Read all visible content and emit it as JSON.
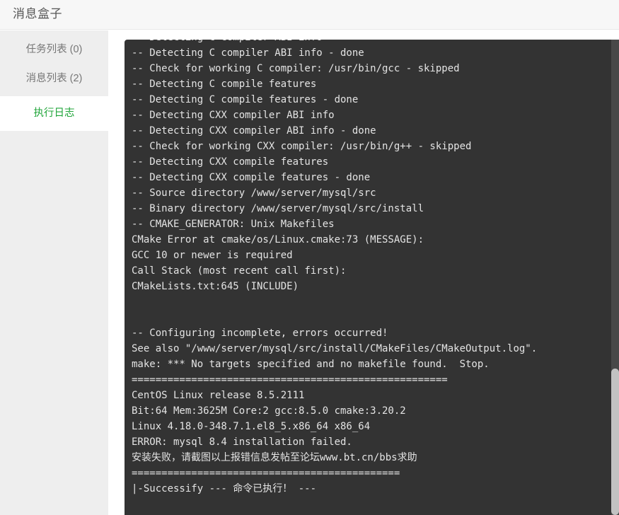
{
  "header": {
    "title": "消息盒子"
  },
  "sidebar": {
    "items": [
      {
        "label": "任务列表 (0)",
        "name": "sidebar-item-task-list",
        "active": false
      },
      {
        "label": "消息列表 (2)",
        "name": "sidebar-item-message-list",
        "active": false
      },
      {
        "label": "执行日志",
        "name": "sidebar-item-execution-log",
        "active": true
      }
    ]
  },
  "colors": {
    "accent_green": "#20a53a",
    "sidebar_bg": "#eeeeee",
    "header_bg": "#f7f7f7",
    "log_bg": "#333333",
    "log_text": "#e4e4e4",
    "scrollbar_thumb": "#c2c2c2",
    "scrollbar_track": "#484848"
  },
  "log": {
    "lines": [
      "-- Detecting C compiler ABI info",
      "-- Detecting C compiler ABI info - done",
      "-- Check for working C compiler: /usr/bin/gcc - skipped",
      "-- Detecting C compile features",
      "-- Detecting C compile features - done",
      "-- Detecting CXX compiler ABI info",
      "-- Detecting CXX compiler ABI info - done",
      "-- Check for working CXX compiler: /usr/bin/g++ - skipped",
      "-- Detecting CXX compile features",
      "-- Detecting CXX compile features - done",
      "-- Source directory /www/server/mysql/src",
      "-- Binary directory /www/server/mysql/src/install",
      "-- CMAKE_GENERATOR: Unix Makefiles",
      "CMake Error at cmake/os/Linux.cmake:73 (MESSAGE):",
      "GCC 10 or newer is required",
      "Call Stack (most recent call first):",
      "CMakeLists.txt:645 (INCLUDE)",
      "",
      "",
      "-- Configuring incomplete, errors occurred!",
      "See also \"/www/server/mysql/src/install/CMakeFiles/CMakeOutput.log\".",
      "make: *** No targets specified and no makefile found.  Stop.",
      "=====================================================",
      "CentOS Linux release 8.5.2111",
      "Bit:64 Mem:3625M Core:2 gcc:8.5.0 cmake:3.20.2",
      "Linux 4.18.0-348.7.1.el8_5.x86_64 x86_64",
      "ERROR: mysql 8.4 installation failed.",
      "安装失败，请截图以上报错信息发帖至论坛www.bt.cn/bbs求助",
      "=============================================",
      "|-Successify --- 命令已执行！ ---"
    ]
  },
  "scrollbar": {
    "name": "log-scrollbar"
  }
}
